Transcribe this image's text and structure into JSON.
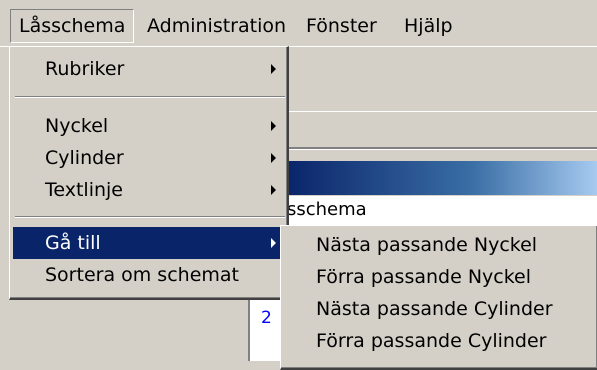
{
  "menubar": {
    "items": [
      {
        "label": "Låsschema"
      },
      {
        "label": "Administration"
      },
      {
        "label": "Fönster"
      },
      {
        "label": "Hjälp"
      }
    ]
  },
  "background": {
    "schema_label": "sschema",
    "row_number": "2"
  },
  "main_menu": {
    "items": [
      {
        "label": "Rubriker"
      },
      {
        "label": "Nyckel"
      },
      {
        "label": "Cylinder"
      },
      {
        "label": "Textlinje"
      },
      {
        "label": "Gå till"
      },
      {
        "label": "Sortera om schemat"
      }
    ]
  },
  "submenu": {
    "items": [
      {
        "label": "Nästa passande Nyckel"
      },
      {
        "label": "Förra passande Nyckel"
      },
      {
        "label": "Nästa passande Cylinder"
      },
      {
        "label": "Förra passande Cylinder"
      }
    ]
  },
  "colors": {
    "menu_bg": "#d4d0c8",
    "highlight": "#0a246a",
    "highlight_text": "#ffffff"
  }
}
